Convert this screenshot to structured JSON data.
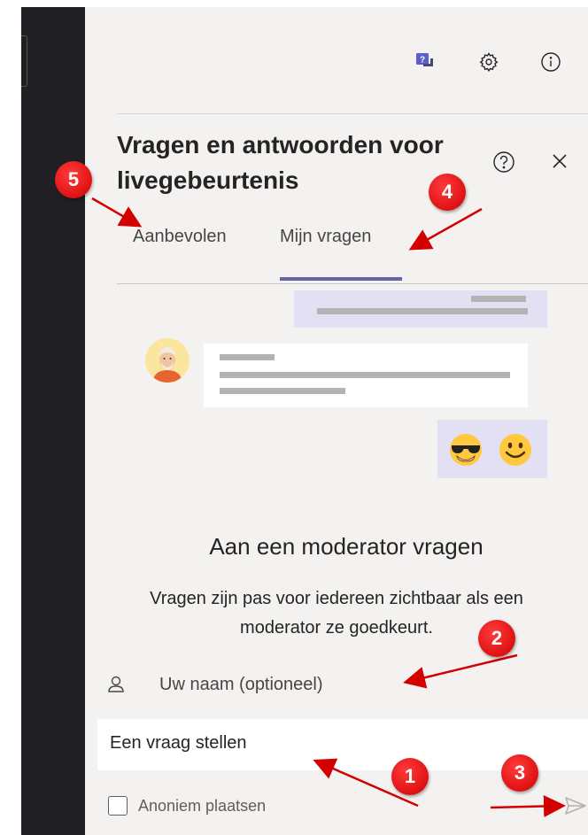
{
  "header": {
    "icons": [
      "qna-icon",
      "gear-icon",
      "info-icon"
    ],
    "title": "Vragen en antwoorden voor livegebeurtenis"
  },
  "tabs": [
    {
      "label": "Aanbevolen",
      "selected": false
    },
    {
      "label": "Mijn vragen",
      "selected": true
    }
  ],
  "ask": {
    "title": "Aan een moderator vragen",
    "description": "Vragen zijn pas voor iedereen zichtbaar als een moderator ze goedkeurt.",
    "description_line1": "Vragen zijn pas voor iedereen zichtbaar als een",
    "description_line2": "moderator ze goedkeurt."
  },
  "form": {
    "name_placeholder": "Uw naam (optioneel)",
    "question_placeholder": "Een vraag stellen",
    "anonymous_label": "Anoniem plaatsen",
    "anonymous_checked": false
  },
  "annotations": [
    {
      "number": "1"
    },
    {
      "number": "2"
    },
    {
      "number": "3"
    },
    {
      "number": "4"
    },
    {
      "number": "5"
    }
  ],
  "colors": {
    "accent": "#6264a7",
    "badge": "#e00000",
    "panel_bg": "#f3f2f1",
    "bubble_bg": "#e2e0f2"
  }
}
